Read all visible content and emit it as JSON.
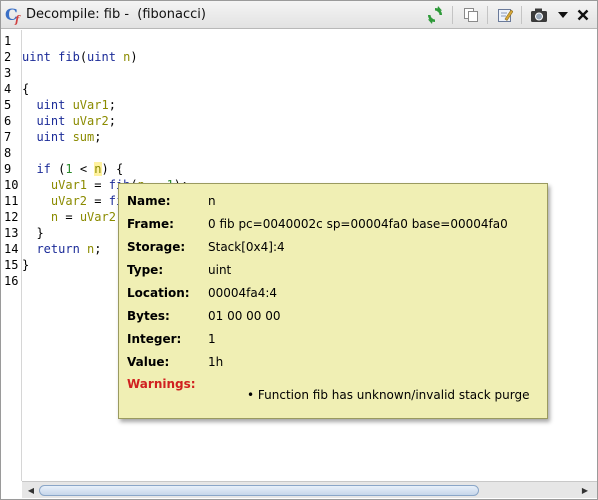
{
  "window": {
    "title": "Decompile: fib -  (fibonacci)",
    "icon": "decompile-icon",
    "toolbar": [
      {
        "name": "refresh-icon",
        "color": "#2e9a3a"
      },
      {
        "name": "copy-icon",
        "color": "#8a8a8a"
      },
      {
        "name": "edit-icon",
        "color": "#b08a2a"
      },
      {
        "name": "snapshot-icon",
        "color": "#333333"
      },
      {
        "name": "menu-dropdown-icon",
        "color": "#111111"
      },
      {
        "name": "close-icon",
        "color": "#111111"
      }
    ]
  },
  "code": {
    "line_numbers": [
      "1",
      "2",
      "3",
      "4",
      "5",
      "6",
      "7",
      "8",
      "9",
      "10",
      "11",
      "12",
      "13",
      "14",
      "15",
      "16"
    ],
    "lines": [
      {
        "parts": []
      },
      {
        "parts": [
          {
            "t": "uint ",
            "c": "kw"
          },
          {
            "t": "fib",
            "c": "fn"
          },
          {
            "t": "(",
            "c": ""
          },
          {
            "t": "uint ",
            "c": "kw"
          },
          {
            "t": "n",
            "c": "var"
          },
          {
            "t": ")",
            "c": ""
          }
        ]
      },
      {
        "parts": []
      },
      {
        "parts": [
          {
            "t": "{",
            "c": ""
          }
        ]
      },
      {
        "parts": [
          {
            "t": "  ",
            "c": ""
          },
          {
            "t": "uint ",
            "c": "kw"
          },
          {
            "t": "uVar1",
            "c": "var"
          },
          {
            "t": ";",
            "c": ""
          }
        ]
      },
      {
        "parts": [
          {
            "t": "  ",
            "c": ""
          },
          {
            "t": "uint ",
            "c": "kw"
          },
          {
            "t": "uVar2",
            "c": "var"
          },
          {
            "t": ";",
            "c": ""
          }
        ]
      },
      {
        "parts": [
          {
            "t": "  ",
            "c": ""
          },
          {
            "t": "uint ",
            "c": "kw"
          },
          {
            "t": "sum",
            "c": "var"
          },
          {
            "t": ";",
            "c": ""
          }
        ]
      },
      {
        "parts": []
      },
      {
        "parts": [
          {
            "t": "  ",
            "c": ""
          },
          {
            "t": "if ",
            "c": "kw"
          },
          {
            "t": "(",
            "c": ""
          },
          {
            "t": "1",
            "c": "num"
          },
          {
            "t": " < ",
            "c": ""
          },
          {
            "t": "n",
            "c": "var hl"
          },
          {
            "t": ") {",
            "c": ""
          }
        ]
      },
      {
        "parts": [
          {
            "t": "    ",
            "c": ""
          },
          {
            "t": "uVar1",
            "c": "var"
          },
          {
            "t": " = ",
            "c": ""
          },
          {
            "t": "fib",
            "c": "fn"
          },
          {
            "t": "(",
            "c": ""
          },
          {
            "t": "n",
            "c": "var"
          },
          {
            "t": " - ",
            "c": ""
          },
          {
            "t": "1",
            "c": "num"
          },
          {
            "t": ");",
            "c": ""
          }
        ]
      },
      {
        "parts": [
          {
            "t": "    ",
            "c": ""
          },
          {
            "t": "uVar2",
            "c": "var"
          },
          {
            "t": " = ",
            "c": ""
          },
          {
            "t": "fi",
            "c": "fn"
          }
        ]
      },
      {
        "parts": [
          {
            "t": "    ",
            "c": ""
          },
          {
            "t": "n",
            "c": "var"
          },
          {
            "t": " = ",
            "c": ""
          },
          {
            "t": "uVar2",
            "c": "var"
          }
        ]
      },
      {
        "parts": [
          {
            "t": "  }",
            "c": ""
          }
        ]
      },
      {
        "parts": [
          {
            "t": "  ",
            "c": ""
          },
          {
            "t": "return ",
            "c": "kw"
          },
          {
            "t": "n",
            "c": "var"
          },
          {
            "t": ";",
            "c": ""
          }
        ]
      },
      {
        "parts": [
          {
            "t": "}",
            "c": ""
          }
        ]
      },
      {
        "parts": []
      }
    ]
  },
  "popup": {
    "fields": [
      {
        "label": "Name:",
        "value": "n"
      },
      {
        "label": "Frame:",
        "value": "0 fib pc=0040002c sp=00004fa0 base=00004fa0"
      },
      {
        "label": "Storage:",
        "value": "Stack[0x4]:4"
      },
      {
        "label": "Type:",
        "value": "uint"
      },
      {
        "label": "Location:",
        "value": "00004fa4:4"
      },
      {
        "label": "Bytes:",
        "value": "01 00 00 00"
      },
      {
        "label": "Integer:",
        "value": "1"
      },
      {
        "label": "Value:",
        "value": "1h"
      }
    ],
    "warnings_label": "Warnings:",
    "warning_item": "Function fib has unknown/invalid stack purge",
    "bullet": "•"
  },
  "scrollbar": {
    "left_arrow": "◀",
    "right_arrow": "▶"
  }
}
